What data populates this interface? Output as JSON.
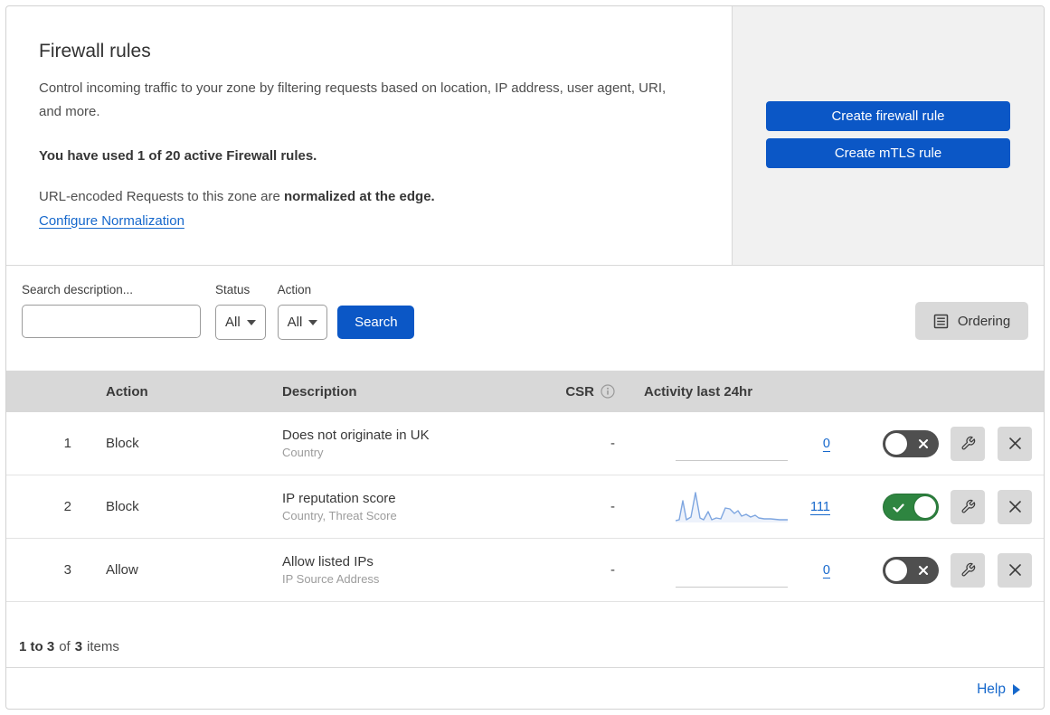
{
  "colors": {
    "accent_blue": "#0b57c6",
    "link_blue": "#1668cc",
    "toggle_on_green": "#2e8540",
    "toggle_off_gray": "#4f4f4f",
    "sparkline_blue": "#7ea6e0",
    "table_header_gray": "#d8d8d8"
  },
  "header": {
    "title": "Firewall rules",
    "description": "Control incoming traffic to your zone by filtering requests based on location, IP address, user agent, URI, and more.",
    "usage": "You have used 1 of 20 active Firewall rules.",
    "normalization_prefix": "URL-encoded Requests to this zone are",
    "normalization_bold": "normalized at the edge.",
    "normalization_link": "Configure Normalization",
    "create_firewall_button": "Create firewall rule",
    "create_mtls_button": "Create mTLS rule"
  },
  "filters": {
    "search_label": "Search description...",
    "search_value": "",
    "status_label": "Status",
    "status_value": "All",
    "action_label": "Action",
    "action_value": "All",
    "search_button": "Search",
    "ordering_button": "Ordering"
  },
  "table": {
    "headers": {
      "action": "Action",
      "description": "Description",
      "csr": "CSR",
      "activity": "Activity last 24hr"
    },
    "rows": [
      {
        "priority": "1",
        "action": "Block",
        "description": "Does not originate in UK",
        "criteria": "Country",
        "csr": "-",
        "activity_count": "0",
        "enabled": false
      },
      {
        "priority": "2",
        "action": "Block",
        "description": "IP reputation score",
        "criteria": "Country, Threat Score",
        "csr": "-",
        "activity_count": "111",
        "enabled": true
      },
      {
        "priority": "3",
        "action": "Allow",
        "description": "Allow listed IPs",
        "criteria": "IP Source Address",
        "csr": "-",
        "activity_count": "0",
        "enabled": false
      }
    ],
    "summary": {
      "range": "1 to 3",
      "of": "of",
      "total": "3",
      "items": "items"
    }
  },
  "footer": {
    "help_label": "Help"
  },
  "sparkline": {
    "points": [
      [
        0,
        34
      ],
      [
        4,
        33
      ],
      [
        8,
        12
      ],
      [
        12,
        33
      ],
      [
        17,
        30
      ],
      [
        22,
        3
      ],
      [
        27,
        31
      ],
      [
        31,
        33
      ],
      [
        36,
        24
      ],
      [
        40,
        33
      ],
      [
        45,
        31
      ],
      [
        50,
        32
      ],
      [
        55,
        20
      ],
      [
        60,
        21
      ],
      [
        65,
        26
      ],
      [
        69,
        23
      ],
      [
        73,
        29
      ],
      [
        78,
        27
      ],
      [
        83,
        30
      ],
      [
        88,
        28
      ],
      [
        92,
        31
      ],
      [
        98,
        32
      ],
      [
        105,
        32
      ],
      [
        115,
        33
      ],
      [
        124,
        33
      ]
    ]
  }
}
